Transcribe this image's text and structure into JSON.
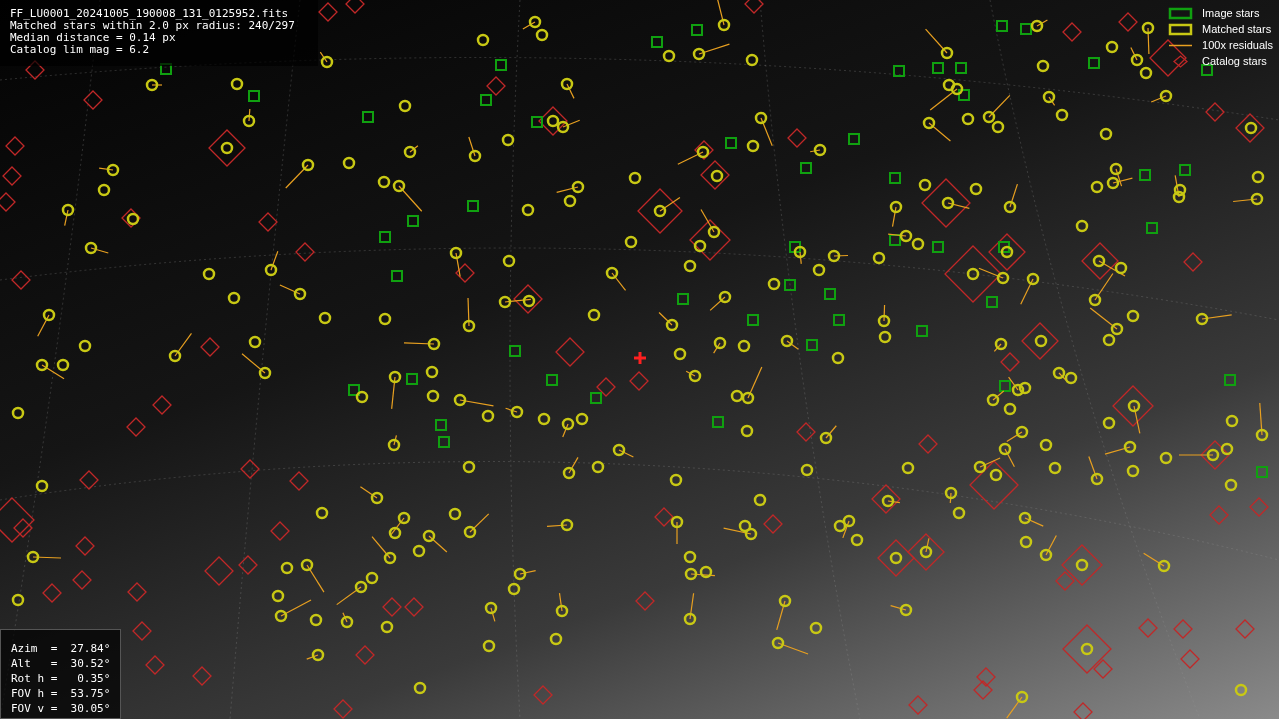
{
  "image_info": {
    "lines": [
      "FF_LU0001_20241005_190008_131_0125952.fits",
      "Matched stars within 2.0 px radius: 240/297",
      "Median distance = 0.14 px",
      "Catalog lim mag = 6.2"
    ]
  },
  "legend": {
    "items": [
      {
        "kind": "image_stars",
        "label": "Image stars"
      },
      {
        "kind": "matched_stars",
        "label": "Matched stars"
      },
      {
        "kind": "residuals",
        "label": "100x residuals"
      },
      {
        "kind": "catalog_stars",
        "label": "Catalog stars"
      }
    ]
  },
  "pointing_info": {
    "lines": [
      "Azim  =  27.84°",
      "Alt   =  30.52°",
      "Rot h =   0.35°",
      "FOV h =  53.75°",
      "FOV v =  30.05°"
    ]
  }
}
